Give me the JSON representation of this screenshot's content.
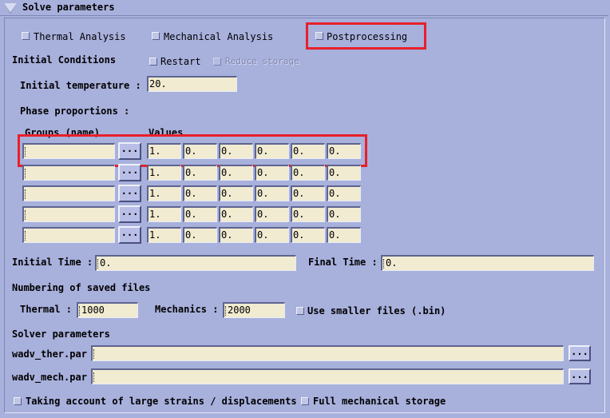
{
  "header": {
    "title": "Solve parameters"
  },
  "analysis": {
    "thermal": "Thermal Analysis",
    "mechanical": "Mechanical Analysis",
    "postprocessing": "Postprocessing"
  },
  "initial_conditions": {
    "label": "Initial Conditions",
    "restart": "Restart",
    "reduce_storage": "Reduce storage"
  },
  "initial_temperature": {
    "label": "Initial temperature :",
    "value": "20."
  },
  "phase": {
    "label": "Phase proportions :",
    "groups_header": "Groups (name)",
    "values_header": "Values",
    "browse": "...",
    "rows": [
      {
        "group": "",
        "values": [
          "1.",
          "0.",
          "0.",
          "0.",
          "0.",
          "0."
        ]
      },
      {
        "group": "",
        "values": [
          "1.",
          "0.",
          "0.",
          "0.",
          "0.",
          "0."
        ]
      },
      {
        "group": "",
        "values": [
          "1.",
          "0.",
          "0.",
          "0.",
          "0.",
          "0."
        ]
      },
      {
        "group": "",
        "values": [
          "1.",
          "0.",
          "0.",
          "0.",
          "0.",
          "0."
        ]
      },
      {
        "group": "",
        "values": [
          "1.",
          "0.",
          "0.",
          "0.",
          "0.",
          "0."
        ]
      }
    ]
  },
  "time": {
    "initial_label": "Initial Time :",
    "initial_value": "0.",
    "final_label": "Final Time :",
    "final_value": "0."
  },
  "saved_files": {
    "label": "Numbering of saved files",
    "thermal_label": "Thermal :",
    "thermal_value": "1000",
    "mechanics_label": "Mechanics :",
    "mechanics_value": "2000",
    "smaller_files": "Use smaller files (.bin)"
  },
  "solver": {
    "label": "Solver parameters",
    "ther_label": "wadv_ther.par",
    "ther_value": "",
    "mech_label": "wadv_mech.par",
    "mech_value": "",
    "browse": "..."
  },
  "options": {
    "large_strains": "Taking account of large strains / displacements",
    "full_storage": "Full mechanical storage"
  },
  "highlight_color": "#e8202a"
}
